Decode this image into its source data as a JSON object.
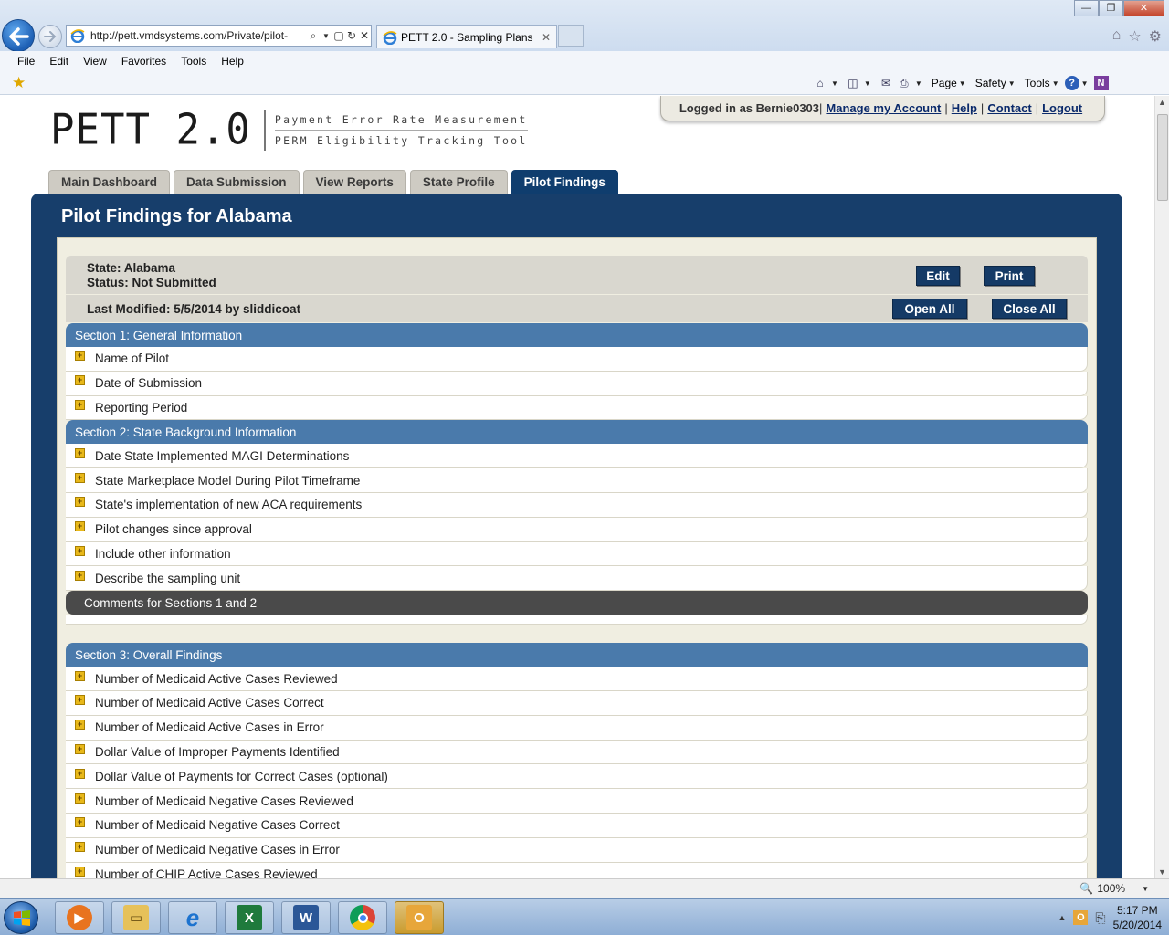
{
  "browser": {
    "url": "http://pett.vmdsystems.com/Private/pilot-",
    "tab_title": "PETT 2.0 - Sampling Plans",
    "menu": [
      "File",
      "Edit",
      "View",
      "Favorites",
      "Tools",
      "Help"
    ],
    "cmd": {
      "page": "Page",
      "safety": "Safety",
      "tools": "Tools"
    },
    "zoom": "100%"
  },
  "header": {
    "logo_main": "PETT 2.0",
    "logo_line1": "Payment Error Rate Measurement",
    "logo_line2": "PERM Eligibility Tracking Tool",
    "logged_in": "Logged in as Bernie0303",
    "links": {
      "manage": "Manage my Account",
      "help": "Help",
      "contact": "Contact",
      "logout": "Logout"
    }
  },
  "tabs": [
    {
      "label": "Main Dashboard",
      "active": false
    },
    {
      "label": "Data Submission",
      "active": false
    },
    {
      "label": "View Reports",
      "active": false
    },
    {
      "label": "State Profile",
      "active": false
    },
    {
      "label": "Pilot Findings",
      "active": true
    }
  ],
  "page": {
    "title": "Pilot Findings for Alabama",
    "state_line": "State: Alabama",
    "status_line": "Status: Not Submitted",
    "modified_line": "Last Modified: 5/5/2014 by sliddicoat",
    "buttons": {
      "edit": "Edit",
      "print": "Print",
      "open_all": "Open All",
      "close_all": "Close All"
    }
  },
  "sections": [
    {
      "title": "Section 1: General Information",
      "items": [
        "Name of Pilot",
        "Date of Submission",
        "Reporting Period"
      ]
    },
    {
      "title": "Section 2: State Background Information",
      "items": [
        "Date State Implemented MAGI Determinations",
        "State Marketplace Model During Pilot Timeframe",
        "State's implementation of new ACA requirements",
        "Pilot changes since approval",
        "Include other information",
        "Describe the sampling unit"
      ]
    },
    {
      "title": "Comments for Sections 1 and 2",
      "comment": true,
      "items": []
    },
    {
      "title": "Section 3: Overall Findings",
      "items": [
        "Number of Medicaid Active Cases Reviewed",
        "Number of Medicaid Active Cases Correct",
        "Number of Medicaid Active Cases in Error",
        "Dollar Value of Improper Payments Identified",
        "Dollar Value of Payments for Correct Cases (optional)",
        "Number of Medicaid Negative Cases Reviewed",
        "Number of Medicaid Negative Cases Correct",
        "Number of Medicaid Negative Cases in Error",
        "Number of CHIP Active Cases Reviewed"
      ]
    }
  ],
  "taskbar": {
    "clock_time": "5:17 PM",
    "clock_date": "5/20/2014",
    "apps": [
      "media-player",
      "file-explorer",
      "internet-explorer",
      "excel",
      "word",
      "chrome",
      "outlook"
    ]
  }
}
